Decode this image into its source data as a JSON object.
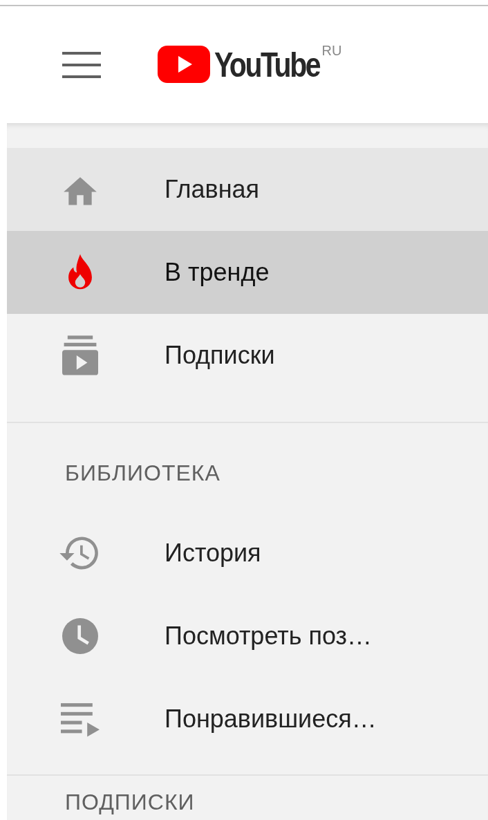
{
  "header": {
    "logo_text": "YouTube",
    "region": "RU"
  },
  "sidebar": {
    "sections": [
      {
        "items": [
          {
            "kind": "home",
            "label": "Главная",
            "selected": false,
            "hovered": true
          },
          {
            "kind": "fire",
            "label": "В тренде",
            "selected": true,
            "hovered": false
          },
          {
            "kind": "subscriptions",
            "label": "Подписки",
            "selected": false,
            "hovered": false
          }
        ]
      },
      {
        "title": "БИБЛИОТЕКА",
        "items": [
          {
            "kind": "history",
            "label": "История",
            "selected": false,
            "hovered": false
          },
          {
            "kind": "clock",
            "label": "Посмотреть поз…",
            "selected": false,
            "hovered": false
          },
          {
            "kind": "playlist",
            "label": "Понравившиеся…",
            "selected": false,
            "hovered": false
          }
        ]
      },
      {
        "title": "ПОДПИСКИ"
      }
    ]
  }
}
